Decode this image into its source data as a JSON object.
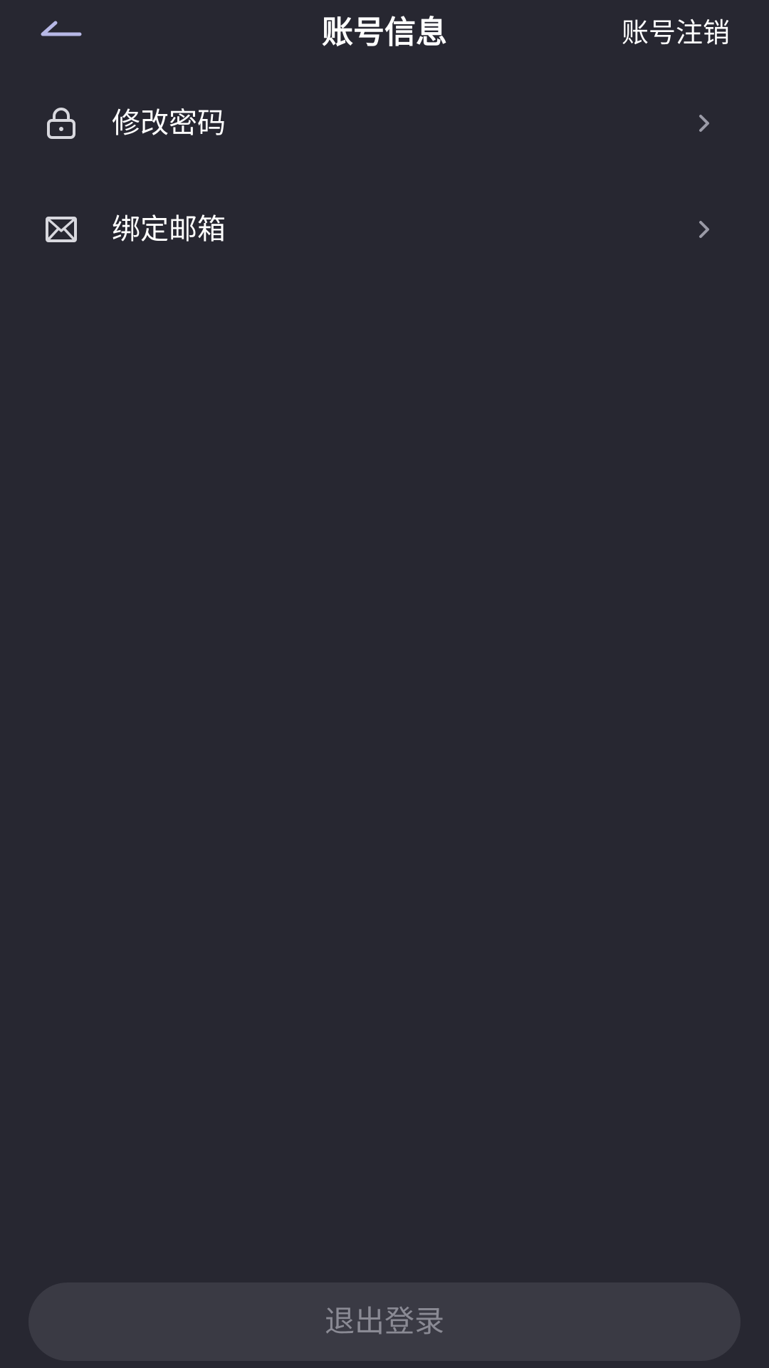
{
  "header": {
    "title": "账号信息",
    "deactivate_label": "账号注销",
    "back_icon": "back-arrow-icon"
  },
  "menu": {
    "items": [
      {
        "label": "修改密码",
        "icon": "lock-icon"
      },
      {
        "label": "绑定邮箱",
        "icon": "mail-icon"
      }
    ]
  },
  "footer": {
    "logout_label": "退出登录"
  },
  "colors": {
    "background": "#272731",
    "text": "#ffffff",
    "chevron": "#9a9aa6",
    "button_bg": "#3a3a44",
    "button_text": "#8a8a94",
    "back_icon": "#b7b8e6"
  }
}
